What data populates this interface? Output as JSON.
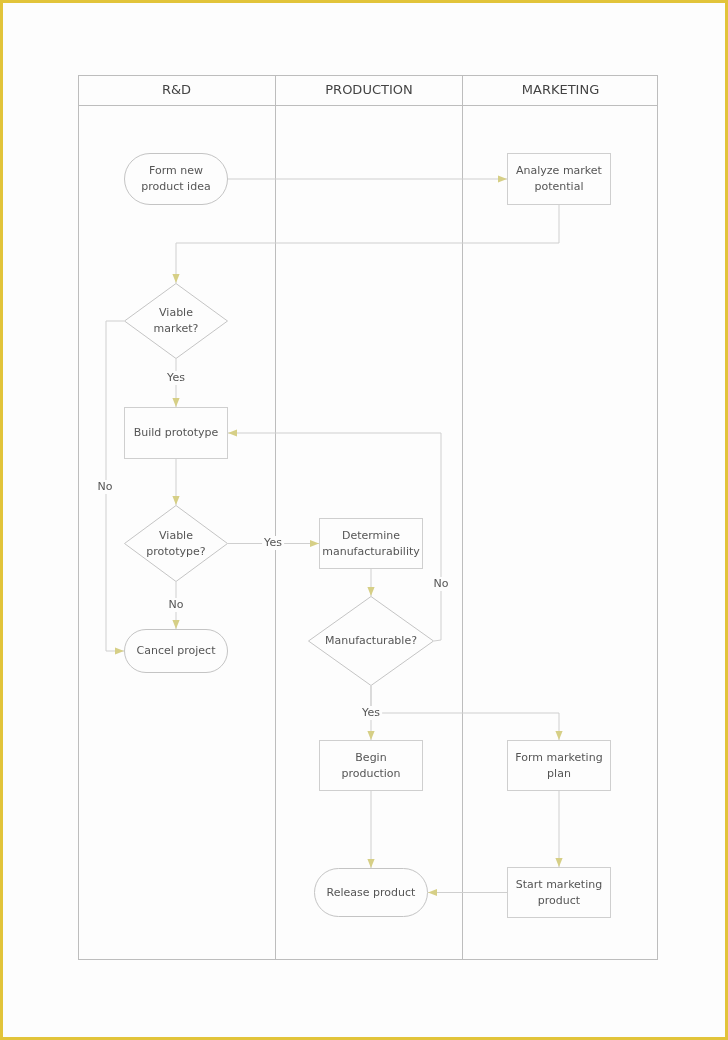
{
  "lanes": [
    {
      "title": "R&D"
    },
    {
      "title": "PRODUCTION"
    },
    {
      "title": "MARKETING"
    }
  ],
  "nodes": [
    {
      "kind": "terminal",
      "lines": [
        "Form new",
        "product idea"
      ]
    },
    {
      "kind": "process",
      "lines": [
        "Analyze market",
        "potential"
      ]
    },
    {
      "kind": "decision",
      "lines": [
        "Viable",
        "market?"
      ]
    },
    {
      "kind": "process",
      "lines": [
        "Build prototype"
      ]
    },
    {
      "kind": "decision",
      "lines": [
        "Viable",
        "prototype?"
      ]
    },
    {
      "kind": "terminal",
      "lines": [
        "Cancel project"
      ]
    },
    {
      "kind": "process",
      "lines": [
        "Determine",
        "manufacturability"
      ]
    },
    {
      "kind": "decision",
      "lines": [
        "Manufacturable?"
      ]
    },
    {
      "kind": "process",
      "lines": [
        "Begin",
        "production"
      ]
    },
    {
      "kind": "process",
      "lines": [
        "Form marketing",
        "plan"
      ]
    },
    {
      "kind": "terminal",
      "lines": [
        "Release product"
      ]
    },
    {
      "kind": "process",
      "lines": [
        "Start marketing",
        "product"
      ]
    }
  ],
  "edge_labels": [
    "Yes",
    "No",
    "Yes",
    "No",
    "No",
    "Yes"
  ]
}
